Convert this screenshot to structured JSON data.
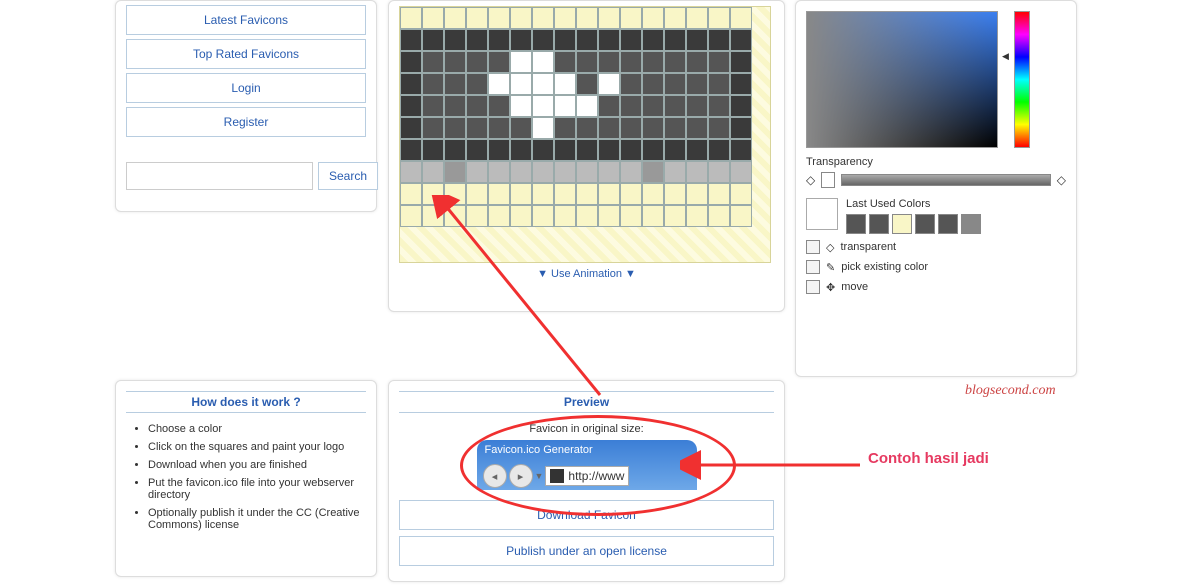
{
  "nav": {
    "items": [
      "Latest Favicons",
      "Top Rated Favicons",
      "Login",
      "Register"
    ],
    "search_btn": "Search"
  },
  "editor": {
    "use_animation": "Use Animation",
    "grid": [
      [
        "#f9f6c7",
        "#f9f6c7",
        "#f9f6c7",
        "#f9f6c7",
        "#f9f6c7",
        "#f9f6c7",
        "#f9f6c7",
        "#f9f6c7",
        "#f9f6c7",
        "#f9f6c7",
        "#f9f6c7",
        "#f9f6c7",
        "#f9f6c7",
        "#f9f6c7",
        "#f9f6c7",
        "#f9f6c7"
      ],
      [
        "#3a3a3a",
        "#3a3a3a",
        "#3a3a3a",
        "#3a3a3a",
        "#3a3a3a",
        "#3a3a3a",
        "#3a3a3a",
        "#3a3a3a",
        "#3a3a3a",
        "#3a3a3a",
        "#3a3a3a",
        "#3a3a3a",
        "#3a3a3a",
        "#3a3a3a",
        "#3a3a3a",
        "#3a3a3a"
      ],
      [
        "#3a3a3a",
        "#555",
        "#555",
        "#555",
        "#555",
        "#fff",
        "#fff",
        "#555",
        "#555",
        "#555",
        "#555",
        "#555",
        "#555",
        "#555",
        "#555",
        "#3a3a3a"
      ],
      [
        "#3a3a3a",
        "#555",
        "#555",
        "#555",
        "#fff",
        "#fff",
        "#fff",
        "#fff",
        "#555",
        "#fff",
        "#555",
        "#555",
        "#555",
        "#555",
        "#555",
        "#3a3a3a"
      ],
      [
        "#3a3a3a",
        "#555",
        "#555",
        "#555",
        "#555",
        "#fff",
        "#fff",
        "#fff",
        "#fff",
        "#555",
        "#555",
        "#555",
        "#555",
        "#555",
        "#555",
        "#3a3a3a"
      ],
      [
        "#3a3a3a",
        "#555",
        "#555",
        "#555",
        "#555",
        "#555",
        "#fff",
        "#555",
        "#555",
        "#555",
        "#555",
        "#555",
        "#555",
        "#555",
        "#555",
        "#3a3a3a"
      ],
      [
        "#3a3a3a",
        "#3a3a3a",
        "#3a3a3a",
        "#3a3a3a",
        "#3a3a3a",
        "#3a3a3a",
        "#3a3a3a",
        "#3a3a3a",
        "#3a3a3a",
        "#3a3a3a",
        "#3a3a3a",
        "#3a3a3a",
        "#3a3a3a",
        "#3a3a3a",
        "#3a3a3a",
        "#3a3a3a"
      ],
      [
        "#bbb",
        "#bbb",
        "#999",
        "#bbb",
        "#bbb",
        "#bbb",
        "#bbb",
        "#bbb",
        "#bbb",
        "#bbb",
        "#bbb",
        "#999",
        "#bbb",
        "#bbb",
        "#bbb",
        "#bbb"
      ],
      [
        "#f9f6c7",
        "#f9f6c7",
        "#f9f6c7",
        "#f9f6c7",
        "#f9f6c7",
        "#f9f6c7",
        "#f9f6c7",
        "#f9f6c7",
        "#f9f6c7",
        "#f9f6c7",
        "#f9f6c7",
        "#f9f6c7",
        "#f9f6c7",
        "#f9f6c7",
        "#f9f6c7",
        "#f9f6c7"
      ],
      [
        "#f9f6c7",
        "#f9f6c7",
        "#f9f6c7",
        "#f9f6c7",
        "#f9f6c7",
        "#f9f6c7",
        "#f9f6c7",
        "#f9f6c7",
        "#f9f6c7",
        "#f9f6c7",
        "#f9f6c7",
        "#f9f6c7",
        "#f9f6c7",
        "#f9f6c7",
        "#f9f6c7",
        "#f9f6c7"
      ]
    ]
  },
  "picker": {
    "transparency_label": "Transparency",
    "last_used_label": "Last Used Colors",
    "last_used": [
      "#555",
      "#555",
      "#f9f6c7",
      "#555",
      "#555",
      "#888"
    ],
    "tools": {
      "transparent": "transparent",
      "pick": "pick existing color",
      "move": "move"
    }
  },
  "how": {
    "title": "How does it work ?",
    "steps": [
      "Choose a color",
      "Click on the squares and paint your logo",
      "Download when you are finished",
      "Put the favicon.ico file into your webserver directory",
      "Optionally publish it under the CC (Creative Commons) license"
    ]
  },
  "preview": {
    "title": "Preview",
    "subtitle": "Favicon in original size:",
    "browser_title": "Favicon.ico Generator",
    "url": "http://www",
    "download": "Download Favicon",
    "publish": "Publish under an open license"
  },
  "annotation": {
    "text": "Contoh hasil jadi",
    "watermark": "blogsecond.com"
  }
}
